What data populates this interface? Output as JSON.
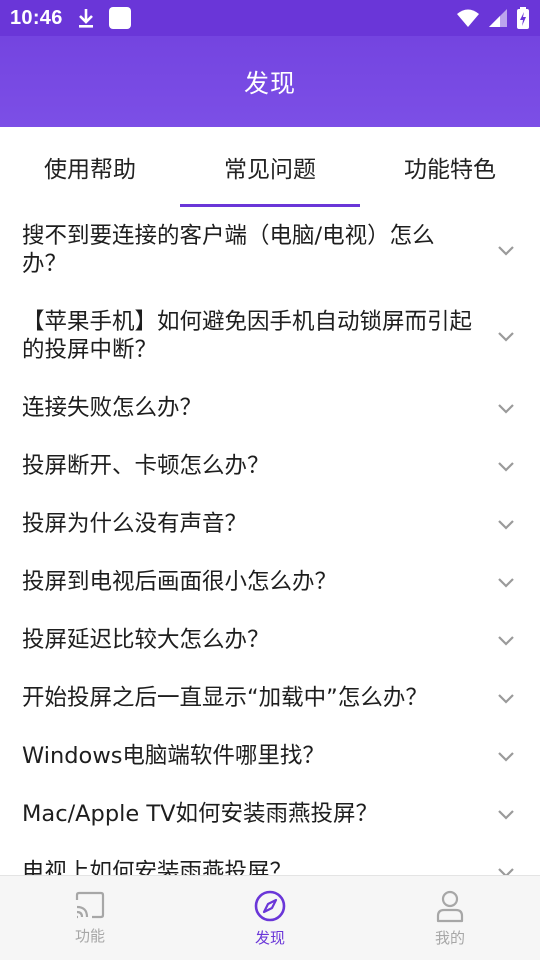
{
  "status": {
    "time": "10:46"
  },
  "header": {
    "title": "发现"
  },
  "tabs": [
    {
      "label": "使用帮助"
    },
    {
      "label": "常见问题"
    },
    {
      "label": "功能特色"
    }
  ],
  "active_tab": "常见问题",
  "faq": [
    {
      "q": "搜不到要连接的客户端（电脑/电视）怎么办？"
    },
    {
      "q": "【苹果手机】如何避免因手机自动锁屏而引起的投屏中断？"
    },
    {
      "q": "连接失败怎么办？"
    },
    {
      "q": "投屏断开、卡顿怎么办？"
    },
    {
      "q": "投屏为什么没有声音？"
    },
    {
      "q": "投屏到电视后画面很小怎么办？"
    },
    {
      "q": "投屏延迟比较大怎么办？"
    },
    {
      "q": "开始投屏之后一直显示“加载中”怎么办？"
    },
    {
      "q": "Windows电脑端软件哪里找？"
    },
    {
      "q": "Mac/Apple TV如何安装雨燕投屏？"
    },
    {
      "q": "电视上如何安装雨燕投屏？"
    }
  ],
  "bottom_nav": [
    {
      "label": "功能",
      "icon": "cast-icon"
    },
    {
      "label": "发现",
      "icon": "compass-icon"
    },
    {
      "label": "我的",
      "icon": "person-icon"
    }
  ],
  "colors": {
    "accent": "#6a36d8",
    "inactive": "#a7a7a7"
  }
}
